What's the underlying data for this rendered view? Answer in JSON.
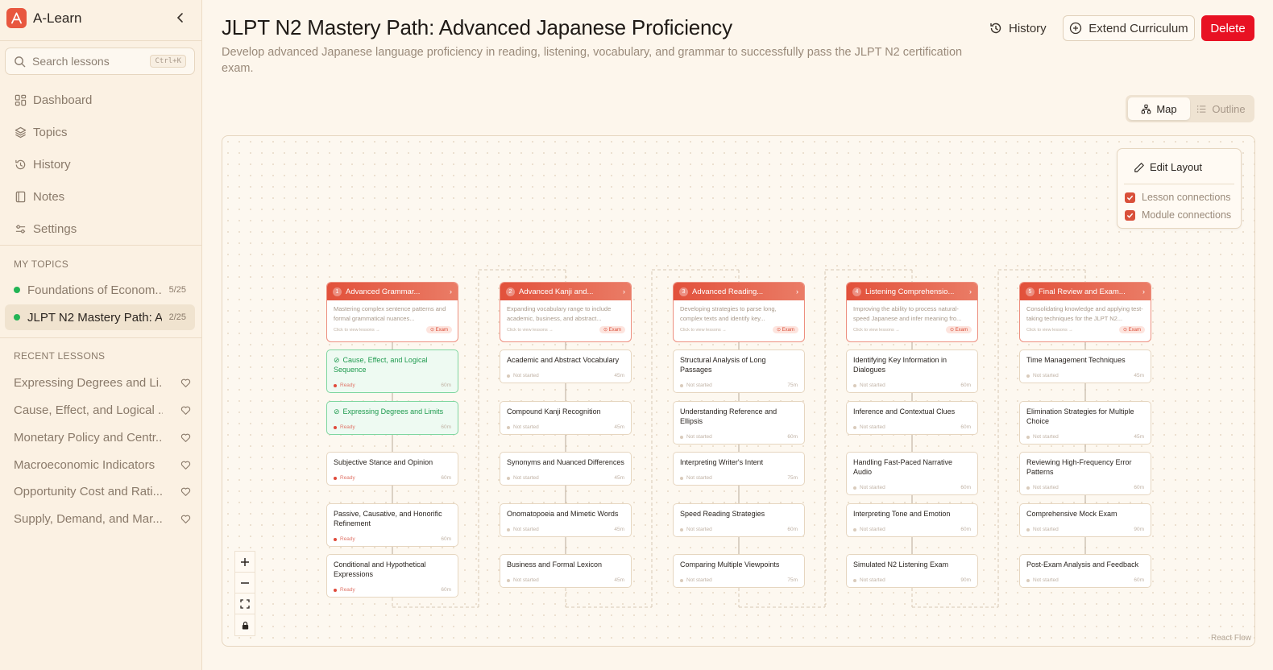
{
  "app": {
    "name": "A-Learn"
  },
  "sidebar": {
    "search_placeholder": "Search lessons",
    "search_shortcut": "Ctrl+K",
    "nav": [
      {
        "label": "Dashboard",
        "icon": "dashboard-icon"
      },
      {
        "label": "Topics",
        "icon": "layers-icon"
      },
      {
        "label": "History",
        "icon": "history-icon"
      },
      {
        "label": "Notes",
        "icon": "notebook-icon"
      },
      {
        "label": "Settings",
        "icon": "sliders-icon"
      }
    ],
    "my_topics_label": "MY TOPICS",
    "my_topics": [
      {
        "title": "Foundations of Econom...",
        "count": "5/25",
        "active": false
      },
      {
        "title": "JLPT N2 Mastery Path: A...",
        "count": "2/25",
        "active": true
      }
    ],
    "recent_label": "RECENT LESSONS",
    "recent": [
      "Expressing Degrees and Li...",
      "Cause, Effect, and Logical ...",
      "Monetary Policy and Centr...",
      "Macroeconomic Indicators",
      "Opportunity Cost and Rati...",
      "Supply, Demand, and Mar..."
    ]
  },
  "header": {
    "title": "JLPT N2 Mastery Path: Advanced Japanese Proficiency",
    "description": "Develop advanced Japanese language proficiency in reading, listening, vocabulary, and grammar to successfully pass the JLPT N2 certification exam.",
    "history_label": "History",
    "extend_label": "Extend Curriculum",
    "delete_label": "Delete"
  },
  "view_toggle": {
    "map_label": "Map",
    "outline_label": "Outline",
    "active": "Map"
  },
  "layout_panel": {
    "edit_label": "Edit Layout",
    "lesson_connections_label": "Lesson connections",
    "lesson_connections_checked": true,
    "module_connections_label": "Module connections",
    "module_connections_checked": true
  },
  "flow": {
    "attribution": "React Flow",
    "module_hint": "Click to view lessons →",
    "exam_label": "Exam",
    "modules": [
      {
        "num": "1",
        "title": "Advanced Grammar...",
        "desc": "Mastering complex sentence patterns and formal grammatical nuances...",
        "lessons": [
          {
            "title": "Cause, Effect, and Logical Sequence",
            "status": "Ready",
            "duration": "60m",
            "highlight": true
          },
          {
            "title": "Expressing Degrees and Limits",
            "status": "Ready",
            "duration": "60m",
            "highlight": true
          },
          {
            "title": "Subjective Stance and Opinion",
            "status": "Ready",
            "duration": "60m",
            "highlight": false
          },
          {
            "title": "Passive, Causative, and Honorific Refinement",
            "status": "Ready",
            "duration": "60m",
            "highlight": false
          },
          {
            "title": "Conditional and Hypothetical Expressions",
            "status": "Ready",
            "duration": "60m",
            "highlight": false
          }
        ]
      },
      {
        "num": "2",
        "title": "Advanced Kanji and...",
        "desc": "Expanding vocabulary range to include academic, business, and abstract...",
        "lessons": [
          {
            "title": "Academic and Abstract Vocabulary",
            "status": "Not started",
            "duration": "45m"
          },
          {
            "title": "Compound Kanji Recognition",
            "status": "Not started",
            "duration": "45m"
          },
          {
            "title": "Synonyms and Nuanced Differences",
            "status": "Not started",
            "duration": "45m"
          },
          {
            "title": "Onomatopoeia and Mimetic Words",
            "status": "Not started",
            "duration": "45m"
          },
          {
            "title": "Business and Formal Lexicon",
            "status": "Not started",
            "duration": "45m"
          }
        ]
      },
      {
        "num": "3",
        "title": "Advanced Reading...",
        "desc": "Developing strategies to parse long, complex texts and identify key...",
        "lessons": [
          {
            "title": "Structural Analysis of Long Passages",
            "status": "Not started",
            "duration": "75m"
          },
          {
            "title": "Understanding Reference and Ellipsis",
            "status": "Not started",
            "duration": "60m"
          },
          {
            "title": "Interpreting Writer's Intent",
            "status": "Not started",
            "duration": "75m"
          },
          {
            "title": "Speed Reading Strategies",
            "status": "Not started",
            "duration": "60m"
          },
          {
            "title": "Comparing Multiple Viewpoints",
            "status": "Not started",
            "duration": "75m"
          }
        ]
      },
      {
        "num": "4",
        "title": "Listening Comprehensio...",
        "desc": "Improving the ability to process natural-speed Japanese and infer meaning fro...",
        "lessons": [
          {
            "title": "Identifying Key Information in Dialogues",
            "status": "Not started",
            "duration": "60m"
          },
          {
            "title": "Inference and Contextual Clues",
            "status": "Not started",
            "duration": "60m"
          },
          {
            "title": "Handling Fast-Paced Narrative Audio",
            "status": "Not started",
            "duration": "60m"
          },
          {
            "title": "Interpreting Tone and Emotion",
            "status": "Not started",
            "duration": "60m"
          },
          {
            "title": "Simulated N2 Listening Exam",
            "status": "Not started",
            "duration": "90m"
          }
        ]
      },
      {
        "num": "5",
        "title": "Final Review and Exam...",
        "desc": "Consolidating knowledge and applying test-taking techniques for the JLPT N2...",
        "lessons": [
          {
            "title": "Time Management Techniques",
            "status": "Not started",
            "duration": "45m"
          },
          {
            "title": "Elimination Strategies for Multiple Choice",
            "status": "Not started",
            "duration": "45m"
          },
          {
            "title": "Reviewing High-Frequency Error Patterns",
            "status": "Not started",
            "duration": "60m"
          },
          {
            "title": "Comprehensive Mock Exam",
            "status": "Not started",
            "duration": "90m"
          },
          {
            "title": "Post-Exam Analysis and Feedback",
            "status": "Not started",
            "duration": "60m"
          }
        ]
      }
    ]
  },
  "colors": {
    "accent": "#e2513b",
    "delete": "#e81123",
    "ready_green": "#22b455"
  }
}
